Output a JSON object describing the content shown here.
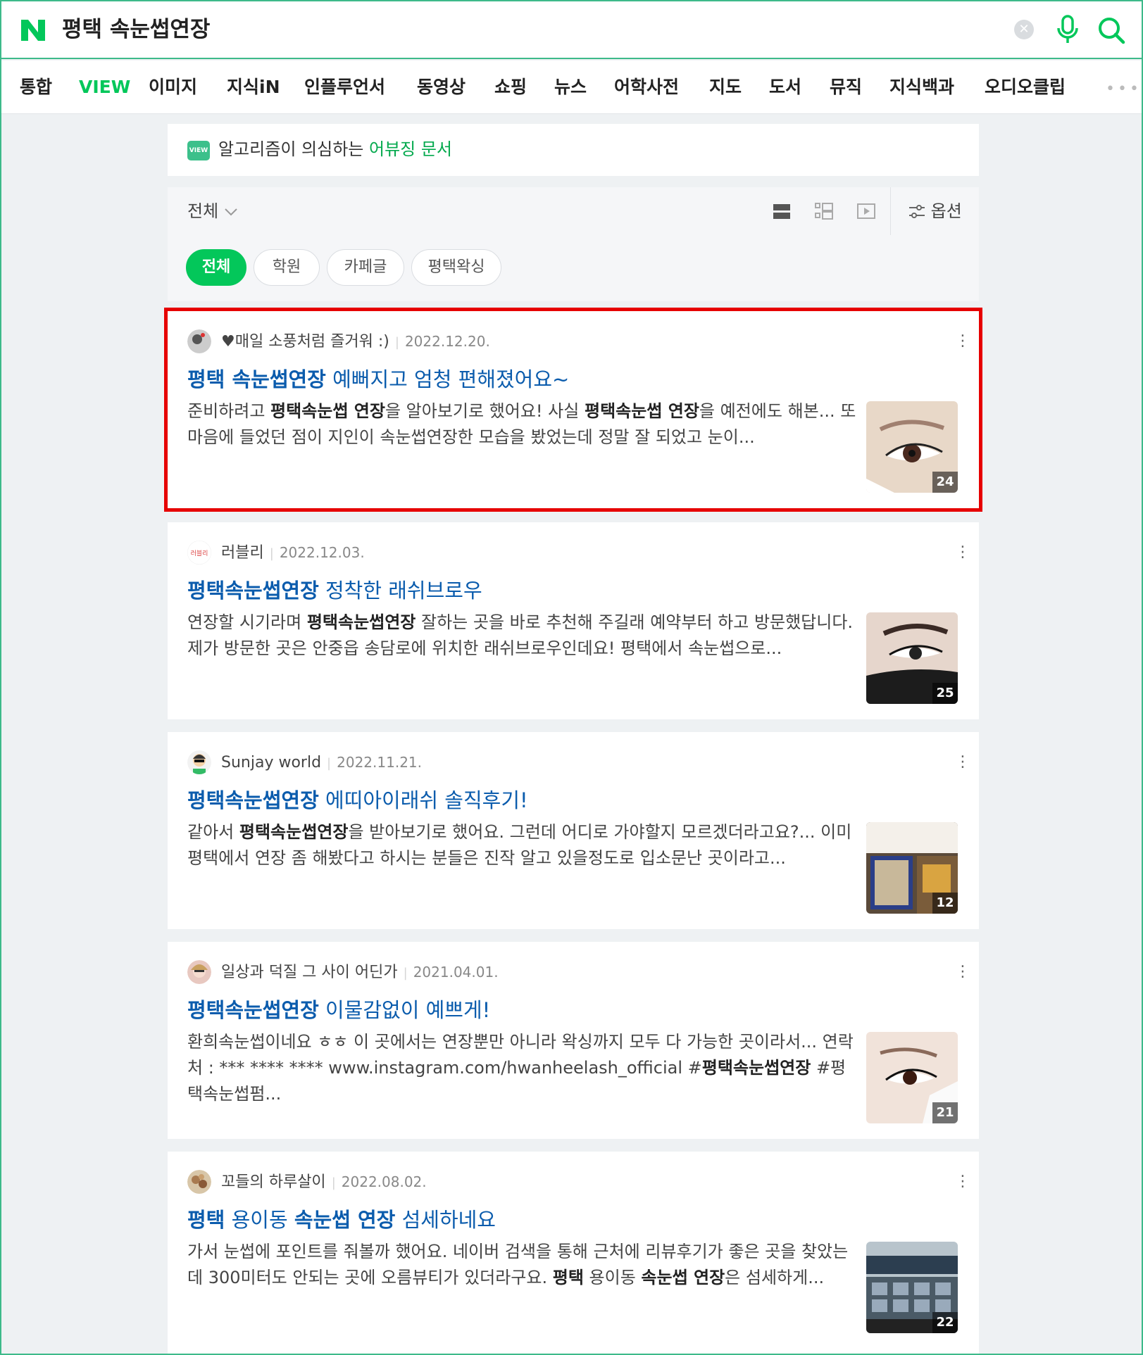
{
  "search": {
    "query": "평택 속눈썹연장",
    "clear_label": "✕"
  },
  "tabs": [
    "통합",
    "VIEW",
    "이미지",
    "지식iN",
    "인플루언서",
    "동영상",
    "쇼핑",
    "뉴스",
    "어학사전",
    "지도",
    "도서",
    "뮤직",
    "지식백과",
    "오디오클립"
  ],
  "tabs_more": "•••",
  "abuse_notice": {
    "badge": "VIEW",
    "text": "알고리즘이 의심하는 ",
    "link": "어뷰징 문서"
  },
  "filter": {
    "dropdown": "전체",
    "options_label": "옵션",
    "chips": [
      "전체",
      "학원",
      "카페글",
      "평택왁싱"
    ]
  },
  "results": [
    {
      "author": "♥매일 소풍처럼 즐거워 :)",
      "date": "2022.12.20.",
      "title_bold": "평택 속눈썹연장",
      "title_rest": " 예뻐지고 엄청 편해졌어요~",
      "desc": "준비하려고 <b>평택속눈썹 연장</b>을 알아보기로 했어요! 사실 <b>평택속눈썹 연장</b>을 예전에도 해본... 또 마음에 들었던 점이 지인이 속눈썹연장한 모습을 봤었는데 정말 잘 되었고 눈이...",
      "image_count": "24"
    },
    {
      "author": "러블리",
      "date": "2022.12.03.",
      "title_bold": "평택속눈썹연장",
      "title_rest": " 정착한 래쉬브로우",
      "desc": "연장할 시기라며 <b>평택속눈썹연장</b> 잘하는 곳을 바로 추천해 주길래 예약부터 하고 방문했답니다. 제가 방문한 곳은 안중읍 송담로에 위치한 래쉬브로우인데요! 평택에서 속눈썹으로...",
      "image_count": "25"
    },
    {
      "author": "Sunjay world",
      "date": "2022.11.21.",
      "title_bold": "평택속눈썹연장",
      "title_rest": " 에띠아이래쉬 솔직후기!",
      "desc": "같아서 <b>평택속눈썹연장</b>을 받아보기로 했어요. 그런데 어디로 가야할지 모르겠더라고요?... 이미 평택에서 연장 좀 해봤다고 하시는 분들은 진작 알고 있을정도로 입소문난 곳이라고...",
      "image_count": "12"
    },
    {
      "author": "일상과 덕질 그 사이 어딘가",
      "date": "2021.04.01.",
      "title_bold": "평택속눈썹연장",
      "title_rest": " 이물감없이 예쁘게!",
      "desc": "환희속눈썹이네요 ㅎㅎ 이 곳에서는 연장뿐만 아니라 왁싱까지 모두 다 가능한 곳이라서... 연락처 : *** **** **** www.instagram.com/hwanheelash_official #<b>평택속눈썹연장</b> #평택속눈썹펌...",
      "image_count": "21"
    },
    {
      "author": "꼬들의 하루살이",
      "date": "2022.08.02.",
      "title_bold": "평택",
      "title_rest": " 용이동 ",
      "title_bold2": "속눈썹 연장",
      "title_rest2": " 섬세하네요",
      "desc": "가서 눈썹에 포인트를 줘볼까 했어요. 네이버 검색을 통해 근처에 리뷰후기가 좋은 곳을 찾았는데 300미터도 안되는 곳에 오름뷰티가 있더라구요. <b>평택</b> 용이동 <b>속눈썹 연장</b>은 섬세하게...",
      "image_count": "22"
    }
  ],
  "colors": {
    "brand": "#03c75a",
    "link": "#0b5cad",
    "highlight": "#e60000"
  }
}
